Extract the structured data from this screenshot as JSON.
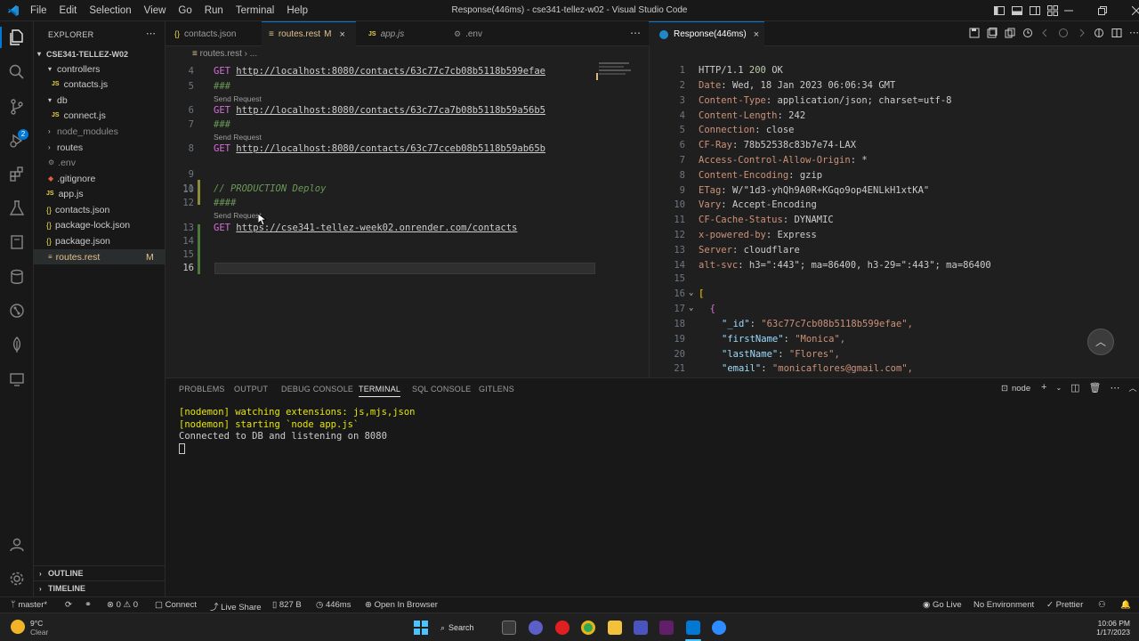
{
  "window": {
    "title": "Response(446ms) - cse341-tellez-w02 - Visual Studio Code",
    "menu": [
      "File",
      "Edit",
      "Selection",
      "View",
      "Go",
      "Run",
      "Terminal",
      "Help"
    ]
  },
  "activity": {
    "scm_badge": "2"
  },
  "explorer": {
    "header": "EXPLORER",
    "root": "CSE341-TELLEZ-W02",
    "items": [
      {
        "label": "controllers",
        "kind": "folder-open"
      },
      {
        "label": "contacts.js",
        "kind": "js"
      },
      {
        "label": "db",
        "kind": "folder-open"
      },
      {
        "label": "connect.js",
        "kind": "js"
      },
      {
        "label": "node_modules",
        "kind": "folder"
      },
      {
        "label": "routes",
        "kind": "folder"
      },
      {
        "label": ".env",
        "kind": "env"
      },
      {
        "label": ".gitignore",
        "kind": "git"
      },
      {
        "label": "app.js",
        "kind": "js"
      },
      {
        "label": "contacts.json",
        "kind": "json"
      },
      {
        "label": "package-lock.json",
        "kind": "json"
      },
      {
        "label": "package.json",
        "kind": "json"
      },
      {
        "label": "routes.rest",
        "kind": "rest",
        "status": "M"
      }
    ],
    "outline": "OUTLINE",
    "timeline": "TIMELINE"
  },
  "tabs_left": [
    {
      "label": "contacts.json",
      "icon": "{}"
    },
    {
      "label": "routes.rest",
      "status": "M"
    },
    {
      "label": "app.js",
      "icon": "JS"
    },
    {
      "label": ".env"
    }
  ],
  "tab_right": {
    "label": "Response(446ms)"
  },
  "breadcrumb": [
    "routes.rest",
    "..."
  ],
  "editor": {
    "lens": "Send Request",
    "lines": [
      {
        "n": "4",
        "method": "GET",
        "url": "http://localhost:8080/contacts/63c77c7cb08b5118b599efae"
      },
      {
        "n": "5",
        "text": "###"
      },
      {
        "n": "6",
        "method": "GET",
        "url": "http://localhost:8080/contacts/63c77ca7b08b5118b59a56b5"
      },
      {
        "n": "7",
        "text": "###"
      },
      {
        "n": "8",
        "method": "GET",
        "url": "http://localhost:8080/contacts/63c77cceb08b5118b59ab65b"
      },
      {
        "n": "9",
        "text": ""
      },
      {
        "n": "10",
        "text": ""
      },
      {
        "n": "11",
        "text": "// PRODUCTION Deploy"
      },
      {
        "n": "12",
        "text": "####"
      },
      {
        "n": "13",
        "method": "GET",
        "url": "https://cse341-tellez-week02.onrender.com/contacts"
      },
      {
        "n": "14",
        "text": ""
      },
      {
        "n": "15",
        "text": ""
      },
      {
        "n": "16",
        "text": ""
      }
    ]
  },
  "response": {
    "status_line": {
      "proto": "HTTP/1.1",
      "code": "200",
      "reason": "OK"
    },
    "headers": [
      {
        "n": "2",
        "key": "Date",
        "value": "Wed, 18 Jan 2023 06:06:34 GMT"
      },
      {
        "n": "3",
        "key": "Content-Type",
        "value": "application/json; charset=utf-8"
      },
      {
        "n": "4",
        "key": "Content-Length",
        "value": "242"
      },
      {
        "n": "5",
        "key": "Connection",
        "value": "close"
      },
      {
        "n": "6",
        "key": "CF-Ray",
        "value": "78b52538c83b7e74-LAX"
      },
      {
        "n": "7",
        "key": "Access-Control-Allow-Origin",
        "value": "*"
      },
      {
        "n": "8",
        "key": "Content-Encoding",
        "value": "gzip"
      },
      {
        "n": "9",
        "key": "ETag",
        "value": "W/\"1d3-yhQh9A0R+KGqo9op4ENLkH1xtKA\""
      },
      {
        "n": "10",
        "key": "Vary",
        "value": "Accept-Encoding"
      },
      {
        "n": "11",
        "key": "CF-Cache-Status",
        "value": "DYNAMIC"
      },
      {
        "n": "12",
        "key": "x-powered-by",
        "value": "Express"
      },
      {
        "n": "13",
        "key": "Server",
        "value": "cloudflare"
      },
      {
        "n": "14",
        "key": "alt-svc",
        "value": "h3=\":443\"; ma=86400, h3-29=\":443\"; ma=86400"
      }
    ],
    "body": [
      {
        "n": "15",
        "text": ""
      },
      {
        "n": "16",
        "text": "["
      },
      {
        "n": "17",
        "text": "  {"
      },
      {
        "n": "18",
        "key": "\"_id\"",
        "value": "\"63c77c7cb08b5118b599efae\","
      },
      {
        "n": "19",
        "key": "\"firstName\"",
        "value": "\"Monica\","
      },
      {
        "n": "20",
        "key": "\"lastName\"",
        "value": "\"Flores\","
      },
      {
        "n": "21",
        "key": "\"email\"",
        "value": "\"monicaflores@gmail.com\","
      }
    ]
  },
  "panel": {
    "tabs": [
      "PROBLEMS",
      "OUTPUT",
      "DEBUG CONSOLE",
      "TERMINAL",
      "SQL CONSOLE",
      "GITLENS"
    ],
    "active_tab": "TERMINAL",
    "shell": "node",
    "terminal_lines": [
      "[nodemon] watching extensions: js,mjs,json",
      "[nodemon] starting `node app.js`",
      "Connected to DB and listening on 8080"
    ]
  },
  "statusbar": {
    "branch": "master*",
    "errors": "0",
    "warnings": "0",
    "connect": "Connect",
    "live_share": "Live Share",
    "size": "827 B",
    "time": "446ms",
    "open_browser": "Open In Browser",
    "go_live": "Go Live",
    "environment": "No Environment",
    "prettier": "Prettier"
  },
  "taskbar": {
    "weather_temp": "9°C",
    "weather_desc": "Clear",
    "search": "Search",
    "clock_time": "10:06 PM",
    "clock_date": "1/17/2023"
  }
}
